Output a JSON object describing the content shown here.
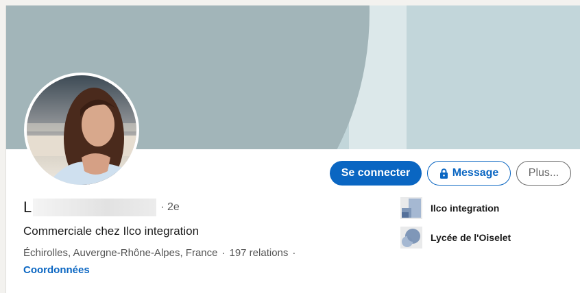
{
  "profile": {
    "name_initial": "L",
    "degree": "· 2e",
    "headline": "Commerciale chez Ilco integration",
    "location": "Échirolles, Auvergne-Rhône-Alpes, France",
    "separator": "·",
    "relations": "197 relations",
    "contact_link": "Coordonnées"
  },
  "actions": {
    "connect": "Se connecter",
    "message": "Message",
    "more": "Plus..."
  },
  "experience": [
    {
      "name": "Ilco integration"
    },
    {
      "name": "Lycée de l'Oiselet"
    }
  ],
  "colors": {
    "primary": "#0a66c2",
    "banner_light": "#c2d6da",
    "banner_dark": "#a2b5b9"
  }
}
